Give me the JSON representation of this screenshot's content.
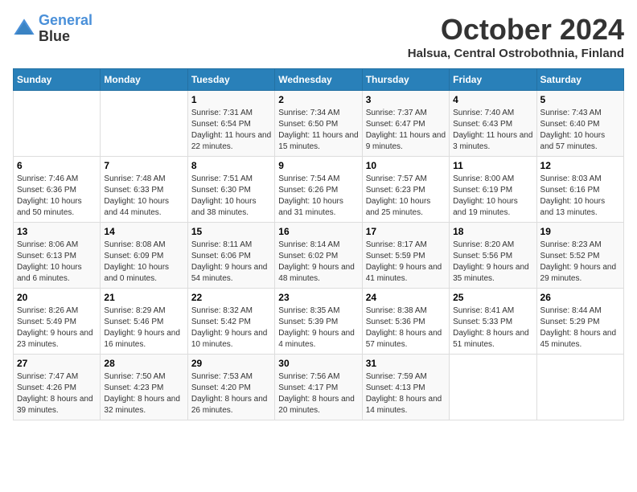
{
  "header": {
    "logo_line1": "General",
    "logo_line2": "Blue",
    "month": "October 2024",
    "location": "Halsua, Central Ostrobothnia, Finland"
  },
  "days_of_week": [
    "Sunday",
    "Monday",
    "Tuesday",
    "Wednesday",
    "Thursday",
    "Friday",
    "Saturday"
  ],
  "weeks": [
    [
      {
        "day": "",
        "info": ""
      },
      {
        "day": "",
        "info": ""
      },
      {
        "day": "1",
        "info": "Sunrise: 7:31 AM\nSunset: 6:54 PM\nDaylight: 11 hours\nand 22 minutes."
      },
      {
        "day": "2",
        "info": "Sunrise: 7:34 AM\nSunset: 6:50 PM\nDaylight: 11 hours\nand 15 minutes."
      },
      {
        "day": "3",
        "info": "Sunrise: 7:37 AM\nSunset: 6:47 PM\nDaylight: 11 hours\nand 9 minutes."
      },
      {
        "day": "4",
        "info": "Sunrise: 7:40 AM\nSunset: 6:43 PM\nDaylight: 11 hours\nand 3 minutes."
      },
      {
        "day": "5",
        "info": "Sunrise: 7:43 AM\nSunset: 6:40 PM\nDaylight: 10 hours\nand 57 minutes."
      }
    ],
    [
      {
        "day": "6",
        "info": "Sunrise: 7:46 AM\nSunset: 6:36 PM\nDaylight: 10 hours\nand 50 minutes."
      },
      {
        "day": "7",
        "info": "Sunrise: 7:48 AM\nSunset: 6:33 PM\nDaylight: 10 hours\nand 44 minutes."
      },
      {
        "day": "8",
        "info": "Sunrise: 7:51 AM\nSunset: 6:30 PM\nDaylight: 10 hours\nand 38 minutes."
      },
      {
        "day": "9",
        "info": "Sunrise: 7:54 AM\nSunset: 6:26 PM\nDaylight: 10 hours\nand 31 minutes."
      },
      {
        "day": "10",
        "info": "Sunrise: 7:57 AM\nSunset: 6:23 PM\nDaylight: 10 hours\nand 25 minutes."
      },
      {
        "day": "11",
        "info": "Sunrise: 8:00 AM\nSunset: 6:19 PM\nDaylight: 10 hours\nand 19 minutes."
      },
      {
        "day": "12",
        "info": "Sunrise: 8:03 AM\nSunset: 6:16 PM\nDaylight: 10 hours\nand 13 minutes."
      }
    ],
    [
      {
        "day": "13",
        "info": "Sunrise: 8:06 AM\nSunset: 6:13 PM\nDaylight: 10 hours\nand 6 minutes."
      },
      {
        "day": "14",
        "info": "Sunrise: 8:08 AM\nSunset: 6:09 PM\nDaylight: 10 hours\nand 0 minutes."
      },
      {
        "day": "15",
        "info": "Sunrise: 8:11 AM\nSunset: 6:06 PM\nDaylight: 9 hours\nand 54 minutes."
      },
      {
        "day": "16",
        "info": "Sunrise: 8:14 AM\nSunset: 6:02 PM\nDaylight: 9 hours\nand 48 minutes."
      },
      {
        "day": "17",
        "info": "Sunrise: 8:17 AM\nSunset: 5:59 PM\nDaylight: 9 hours\nand 41 minutes."
      },
      {
        "day": "18",
        "info": "Sunrise: 8:20 AM\nSunset: 5:56 PM\nDaylight: 9 hours\nand 35 minutes."
      },
      {
        "day": "19",
        "info": "Sunrise: 8:23 AM\nSunset: 5:52 PM\nDaylight: 9 hours\nand 29 minutes."
      }
    ],
    [
      {
        "day": "20",
        "info": "Sunrise: 8:26 AM\nSunset: 5:49 PM\nDaylight: 9 hours\nand 23 minutes."
      },
      {
        "day": "21",
        "info": "Sunrise: 8:29 AM\nSunset: 5:46 PM\nDaylight: 9 hours\nand 16 minutes."
      },
      {
        "day": "22",
        "info": "Sunrise: 8:32 AM\nSunset: 5:42 PM\nDaylight: 9 hours\nand 10 minutes."
      },
      {
        "day": "23",
        "info": "Sunrise: 8:35 AM\nSunset: 5:39 PM\nDaylight: 9 hours\nand 4 minutes."
      },
      {
        "day": "24",
        "info": "Sunrise: 8:38 AM\nSunset: 5:36 PM\nDaylight: 8 hours\nand 57 minutes."
      },
      {
        "day": "25",
        "info": "Sunrise: 8:41 AM\nSunset: 5:33 PM\nDaylight: 8 hours\nand 51 minutes."
      },
      {
        "day": "26",
        "info": "Sunrise: 8:44 AM\nSunset: 5:29 PM\nDaylight: 8 hours\nand 45 minutes."
      }
    ],
    [
      {
        "day": "27",
        "info": "Sunrise: 7:47 AM\nSunset: 4:26 PM\nDaylight: 8 hours\nand 39 minutes."
      },
      {
        "day": "28",
        "info": "Sunrise: 7:50 AM\nSunset: 4:23 PM\nDaylight: 8 hours\nand 32 minutes."
      },
      {
        "day": "29",
        "info": "Sunrise: 7:53 AM\nSunset: 4:20 PM\nDaylight: 8 hours\nand 26 minutes."
      },
      {
        "day": "30",
        "info": "Sunrise: 7:56 AM\nSunset: 4:17 PM\nDaylight: 8 hours\nand 20 minutes."
      },
      {
        "day": "31",
        "info": "Sunrise: 7:59 AM\nSunset: 4:13 PM\nDaylight: 8 hours\nand 14 minutes."
      },
      {
        "day": "",
        "info": ""
      },
      {
        "day": "",
        "info": ""
      }
    ]
  ]
}
